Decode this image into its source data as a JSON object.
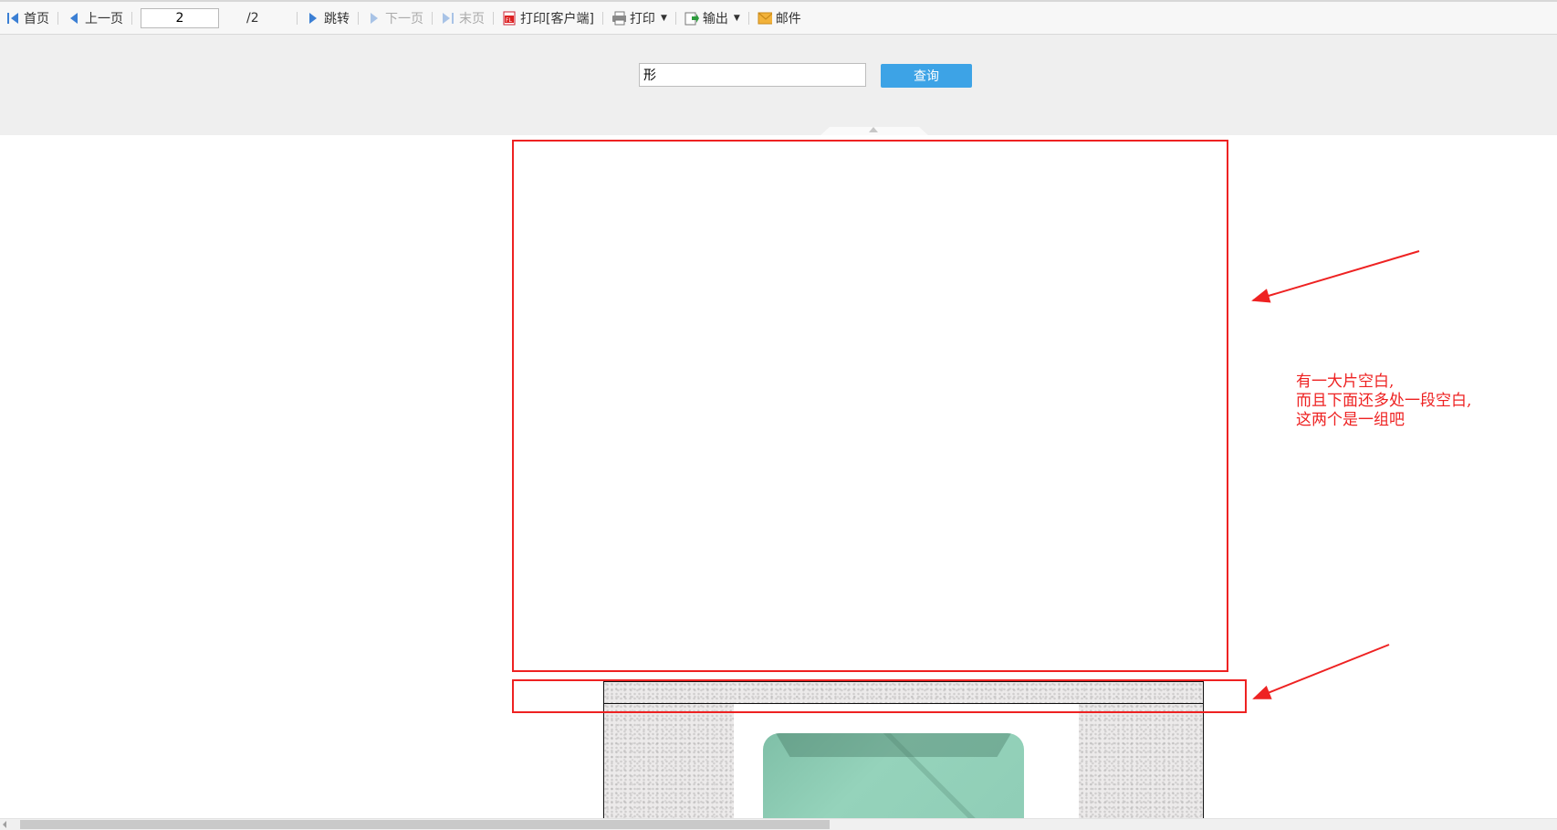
{
  "toolbar": {
    "first_label": "首页",
    "prev_label": "上一页",
    "page_value": "2",
    "page_total": "/2",
    "goto_label": "跳转",
    "next_label": "下一页",
    "last_label": "末页",
    "print_client_label": "打印[客户端]",
    "print_label": "打印",
    "export_label": "输出",
    "mail_label": "邮件"
  },
  "params": {
    "query_value": "形",
    "query_button_label": "查询"
  },
  "annotation": {
    "line1": "有一大片空白,",
    "line2": "而且下面还多处一段空白,",
    "line3": "这两个是一组吧"
  },
  "colors": {
    "annotation_red": "#ee2222",
    "query_button_blue": "#3da3e6",
    "toolbar_icon_blue": "#3b7fd4"
  },
  "icons": [
    "first-page-icon",
    "prev-page-icon",
    "goto-icon",
    "next-page-icon",
    "last-page-icon",
    "pdf-print-icon",
    "printer-icon",
    "export-icon",
    "mail-icon"
  ]
}
